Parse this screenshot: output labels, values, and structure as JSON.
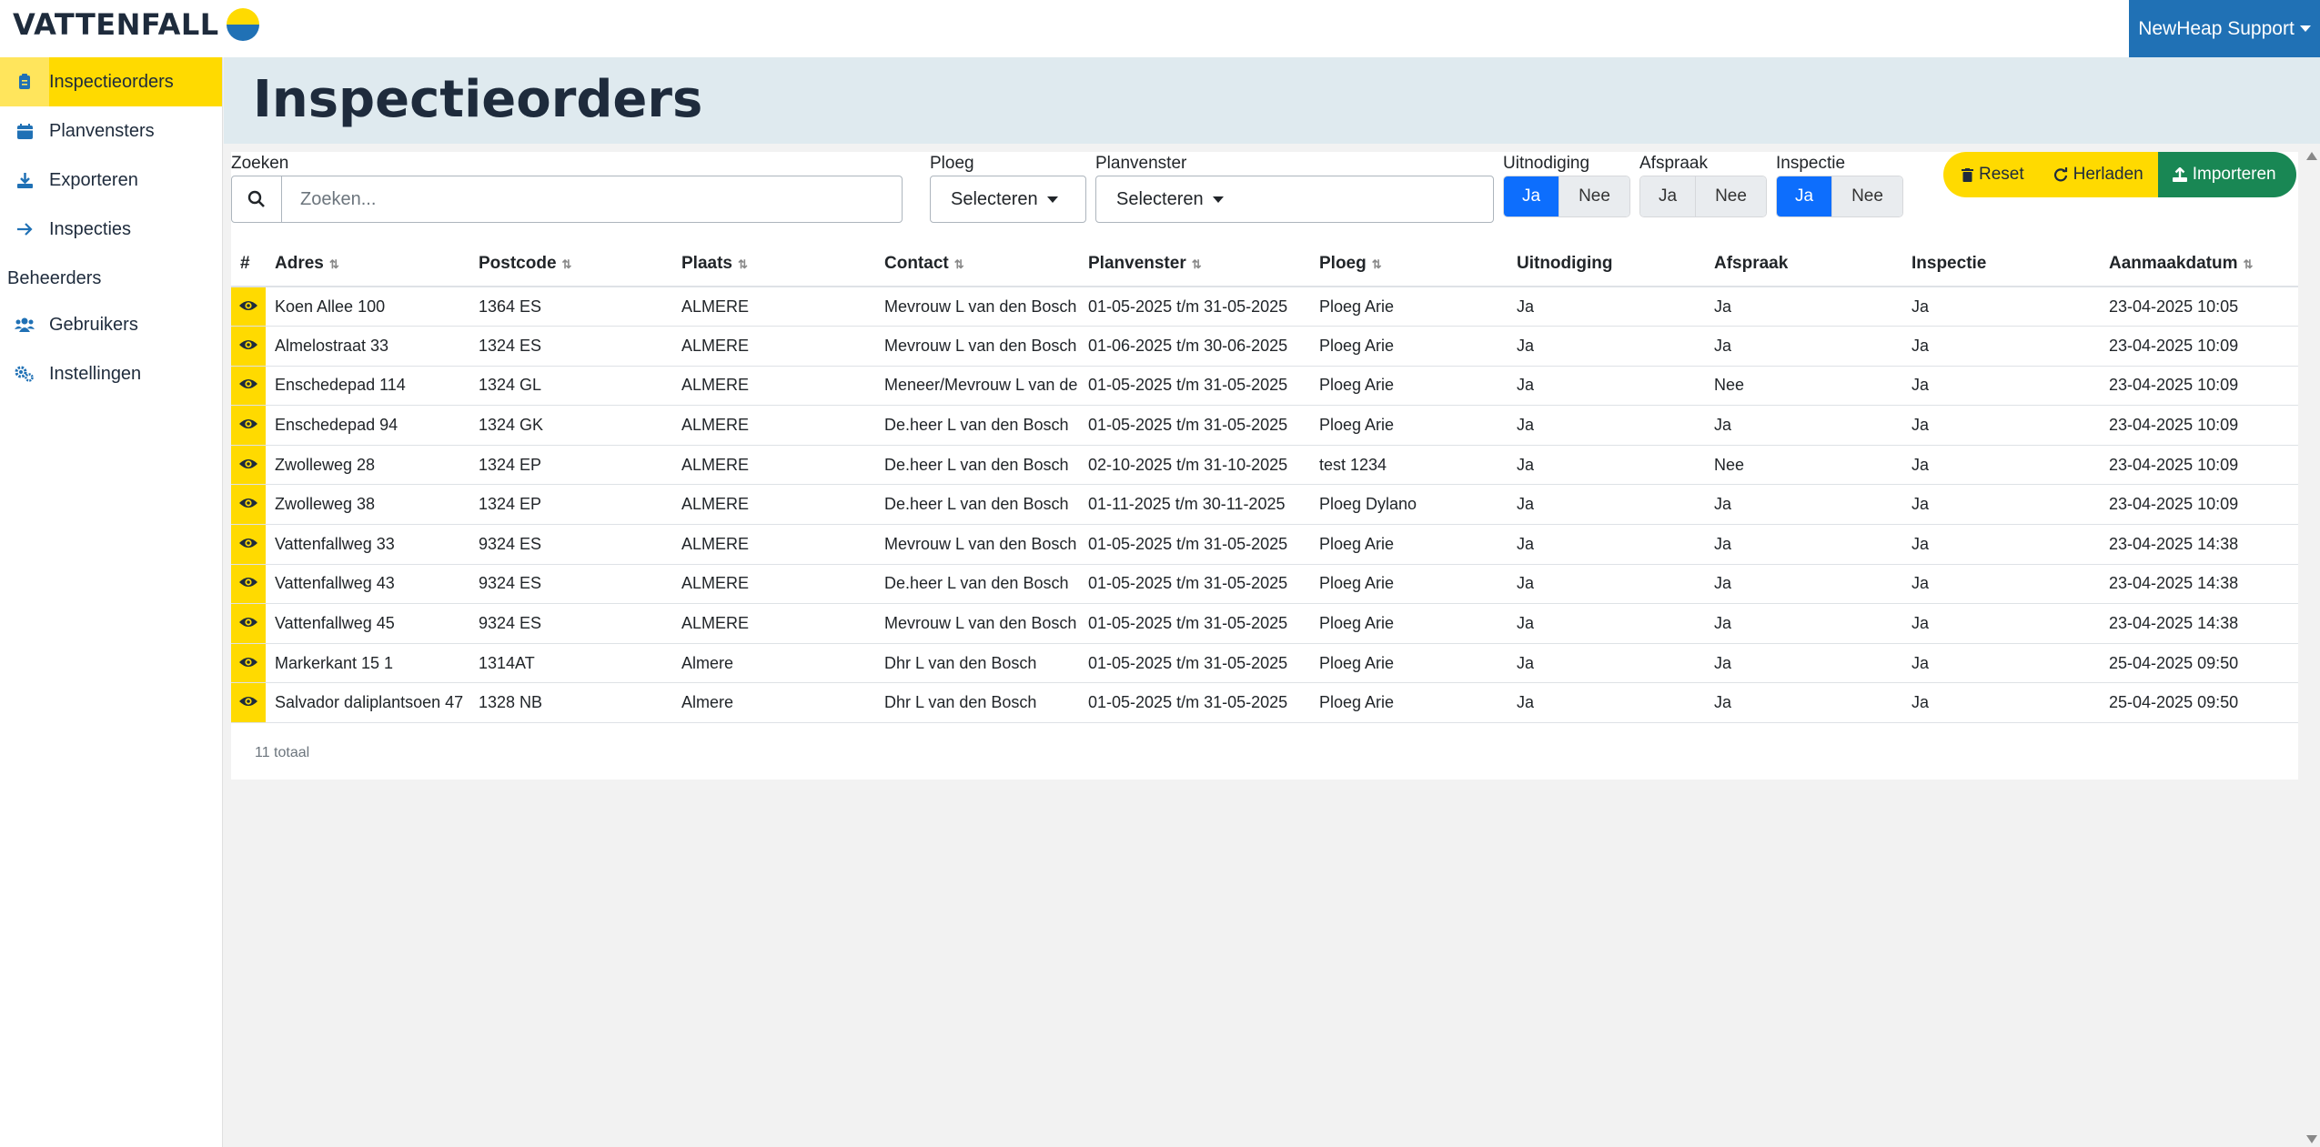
{
  "brand": {
    "name": "VATTENFALL",
    "colors": {
      "yellow": "#ffda00",
      "blue": "#2071b5"
    }
  },
  "user": {
    "label": "NewHeap Support"
  },
  "sidebar": {
    "items": [
      {
        "label": "Inspectieorders",
        "icon": "clipboard-icon",
        "active": true
      },
      {
        "label": "Planvensters",
        "icon": "calendar-icon",
        "active": false
      },
      {
        "label": "Exporteren",
        "icon": "download-icon",
        "active": false
      },
      {
        "label": "Inspecties",
        "icon": "arrow-right-icon",
        "active": false
      }
    ],
    "section": "Beheerders",
    "admin_items": [
      {
        "label": "Gebruikers",
        "icon": "users-icon"
      },
      {
        "label": "Instellingen",
        "icon": "cogs-icon"
      }
    ]
  },
  "page": {
    "title": "Inspectieorders"
  },
  "filters": {
    "search_label": "Zoeken",
    "search_placeholder": "Zoeken...",
    "ploeg_label": "Ploeg",
    "ploeg_value": "Selecteren",
    "planvenster_label": "Planvenster",
    "planvenster_value": "Selecteren",
    "uitnodiging_label": "Uitnodiging",
    "afspraak_label": "Afspraak",
    "inspectie_label": "Inspectie",
    "ja": "Ja",
    "nee": "Nee",
    "uitnodiging_selected": "Ja",
    "afspraak_selected": "none",
    "inspectie_selected": "Ja"
  },
  "actions": {
    "reset": "Reset",
    "herladen": "Herladen",
    "importeren": "Importeren"
  },
  "table": {
    "headers": [
      "#",
      "Adres",
      "Postcode",
      "Plaats",
      "Contact",
      "Planvenster",
      "Ploeg",
      "Uitnodiging",
      "Afspraak",
      "Inspectie",
      "Aanmaakdatum"
    ],
    "rows": [
      [
        "Koen Allee 100",
        "1364 ES",
        "ALMERE",
        "Mevrouw L van den Bosch",
        "01-05-2025 t/m 31-05-2025",
        "Ploeg Arie",
        "Ja",
        "Ja",
        "Ja",
        "23-04-2025 10:05"
      ],
      [
        "Almelostraat 33",
        "1324 ES",
        "ALMERE",
        "Mevrouw L van den Bosch",
        "01-06-2025 t/m 30-06-2025",
        "Ploeg Arie",
        "Ja",
        "Ja",
        "Ja",
        "23-04-2025 10:09"
      ],
      [
        "Enschedepad 114",
        "1324 GL",
        "ALMERE",
        "Meneer/Mevrouw L van de",
        "01-05-2025 t/m 31-05-2025",
        "Ploeg Arie",
        "Ja",
        "Nee",
        "Ja",
        "23-04-2025 10:09"
      ],
      [
        "Enschedepad 94",
        "1324 GK",
        "ALMERE",
        "De.heer L van den Bosch",
        "01-05-2025 t/m 31-05-2025",
        "Ploeg Arie",
        "Ja",
        "Ja",
        "Ja",
        "23-04-2025 10:09"
      ],
      [
        "Zwolleweg 28",
        "1324 EP",
        "ALMERE",
        "De.heer L van den Bosch",
        "02-10-2025 t/m 31-10-2025",
        "test 1234",
        "Ja",
        "Nee",
        "Ja",
        "23-04-2025 10:09"
      ],
      [
        "Zwolleweg 38",
        "1324 EP",
        "ALMERE",
        "De.heer L van den Bosch",
        "01-11-2025 t/m 30-11-2025",
        "Ploeg Dylano",
        "Ja",
        "Ja",
        "Ja",
        "23-04-2025 10:09"
      ],
      [
        "Vattenfallweg 33",
        "9324 ES",
        "ALMERE",
        "Mevrouw L van den Bosch",
        "01-05-2025 t/m 31-05-2025",
        "Ploeg Arie",
        "Ja",
        "Ja",
        "Ja",
        "23-04-2025 14:38"
      ],
      [
        "Vattenfallweg 43",
        "9324 ES",
        "ALMERE",
        "De.heer L van den Bosch",
        "01-05-2025 t/m 31-05-2025",
        "Ploeg Arie",
        "Ja",
        "Ja",
        "Ja",
        "23-04-2025 14:38"
      ],
      [
        "Vattenfallweg 45",
        "9324 ES",
        "ALMERE",
        "Mevrouw L van den Bosch",
        "01-05-2025 t/m 31-05-2025",
        "Ploeg Arie",
        "Ja",
        "Ja",
        "Ja",
        "23-04-2025 14:38"
      ],
      [
        "Markerkant 15 1",
        "1314AT",
        "Almere",
        "Dhr L van den Bosch",
        "01-05-2025 t/m 31-05-2025",
        "Ploeg Arie",
        "Ja",
        "Ja",
        "Ja",
        "25-04-2025 09:50"
      ],
      [
        "Salvador daliplantsoen 47",
        "1328 NB",
        "Almere",
        "Dhr L van den Bosch",
        "01-05-2025 t/m 31-05-2025",
        "Ploeg Arie",
        "Ja",
        "Ja",
        "Ja",
        "25-04-2025 09:50"
      ]
    ],
    "total": "11 totaal"
  }
}
